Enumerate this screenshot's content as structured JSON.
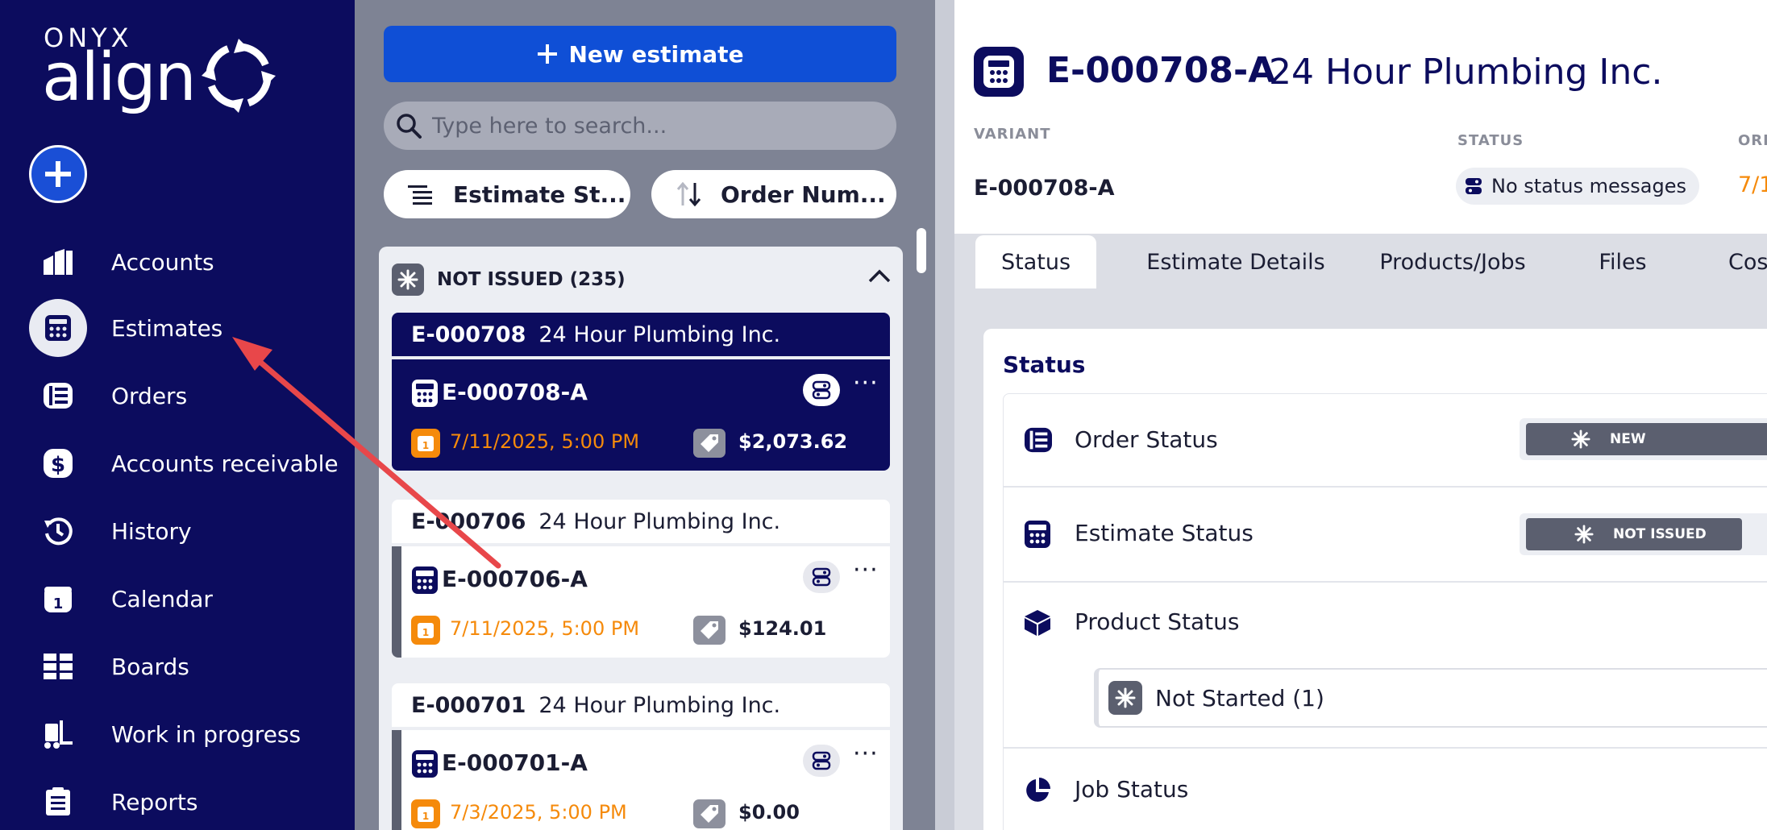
{
  "sidebar": {
    "brand_top": "ONYX",
    "brand_main": "align",
    "items": [
      {
        "label": "Accounts",
        "icon": "accounts-icon"
      },
      {
        "label": "Estimates",
        "icon": "estimates-icon"
      },
      {
        "label": "Orders",
        "icon": "orders-icon"
      },
      {
        "label": "Accounts receivable",
        "icon": "accounts-receivable-icon"
      },
      {
        "label": "History",
        "icon": "history-icon"
      },
      {
        "label": "Calendar",
        "icon": "calendar-icon"
      },
      {
        "label": "Boards",
        "icon": "boards-icon"
      },
      {
        "label": "Work in progress",
        "icon": "work-in-progress-icon"
      },
      {
        "label": "Reports",
        "icon": "reports-icon"
      }
    ],
    "active_item": "Estimates"
  },
  "listpane": {
    "new_button": "New estimate",
    "search_placeholder": "Type here to search...",
    "sort_status": "Estimate St...",
    "sort_order": "Order Num...",
    "group_title": "NOT ISSUED (235)",
    "cards": [
      {
        "number": "E-000708",
        "company": "24 Hour Plumbing Inc.",
        "variant": "E-000708-A",
        "date": "7/11/2025, 5:00 PM",
        "price": "$2,073.62"
      },
      {
        "number": "E-000706",
        "company": "24 Hour Plumbing Inc.",
        "variant": "E-000706-A",
        "date": "7/11/2025, 5:00 PM",
        "price": "$124.01"
      },
      {
        "number": "E-000701",
        "company": "24 Hour Plumbing Inc.",
        "variant": "E-000701-A",
        "date": "7/3/2025, 5:00 PM",
        "price": "$0.00"
      }
    ],
    "more": "···",
    "calendar_day": "1"
  },
  "detail": {
    "title_number": "E-000708-A",
    "title_company": "24 Hour Plumbing Inc.",
    "variant_label": "VARIANT",
    "variant_value": "E-000708-A",
    "status_label": "STATUS",
    "status_value": "No status messages",
    "order_label": "ORD",
    "order_date_clip": "7/1",
    "tabs": [
      "Status",
      "Estimate Details",
      "Products/Jobs",
      "Files",
      "Cos"
    ],
    "section_title": "Status",
    "rows": {
      "order_status": "Order Status",
      "order_status_value": "NEW",
      "estimate_status": "Estimate Status",
      "estimate_status_value": "NOT ISSUED",
      "product_status": "Product Status",
      "product_not_started": "Not Started (1)",
      "job_status": "Job Status"
    }
  },
  "colors": {
    "navy": "#0c0c5e",
    "accent_blue": "#0f4fd6",
    "orange": "#f58a0b",
    "annotation_red": "#e8474a"
  }
}
